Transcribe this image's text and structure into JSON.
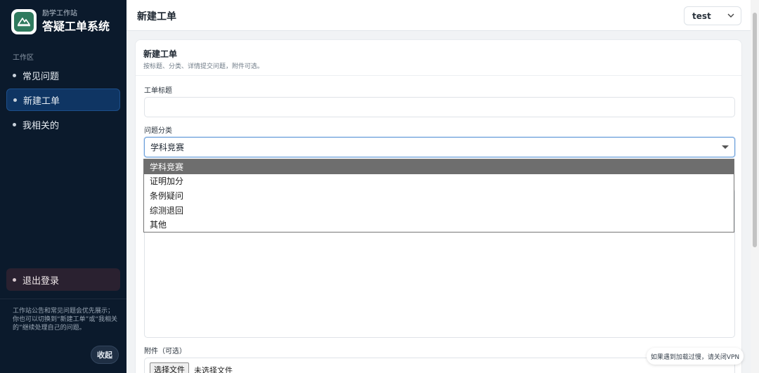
{
  "sidebar": {
    "brand_sub": "励学工作站",
    "brand_title": "答疑工单系统",
    "section_label": "工作区",
    "items": [
      {
        "label": "常见问题",
        "active": false
      },
      {
        "label": "新建工单",
        "active": true
      },
      {
        "label": "我相关的",
        "active": false
      }
    ],
    "logout_label": "退出登录",
    "note": "工作站公告和常见问题会优先展示；你也可以切换到“新建工单”或“我相关的”继续处理自己的问题。",
    "collapse_label": "收起"
  },
  "header": {
    "title": "新建工单",
    "user": "test"
  },
  "card": {
    "title": "新建工单",
    "subtitle": "按标题、分类、详情提交问题，附件可选。",
    "title_field_label": "工单标题",
    "title_field_value": "",
    "category_label": "问题分类",
    "category_selected": "学科竞赛",
    "category_options": [
      "学科竞赛",
      "证明加分",
      "条例疑问",
      "综测退回",
      "其他"
    ],
    "attachment_label": "附件（可选）",
    "file_button_label": "选择文件",
    "file_status": "未选择文件"
  },
  "toast": {
    "message": "如果遇到加载过慢，请关闭VPN"
  },
  "colors": {
    "sidebar_bg": "#0b1a2c",
    "active_item_bg": "#0f3563",
    "logout_bg": "#2a2130",
    "logo_green": "#2f7a5e",
    "focus_border": "#6b9fd9",
    "option_highlight": "#6e6e6e"
  }
}
